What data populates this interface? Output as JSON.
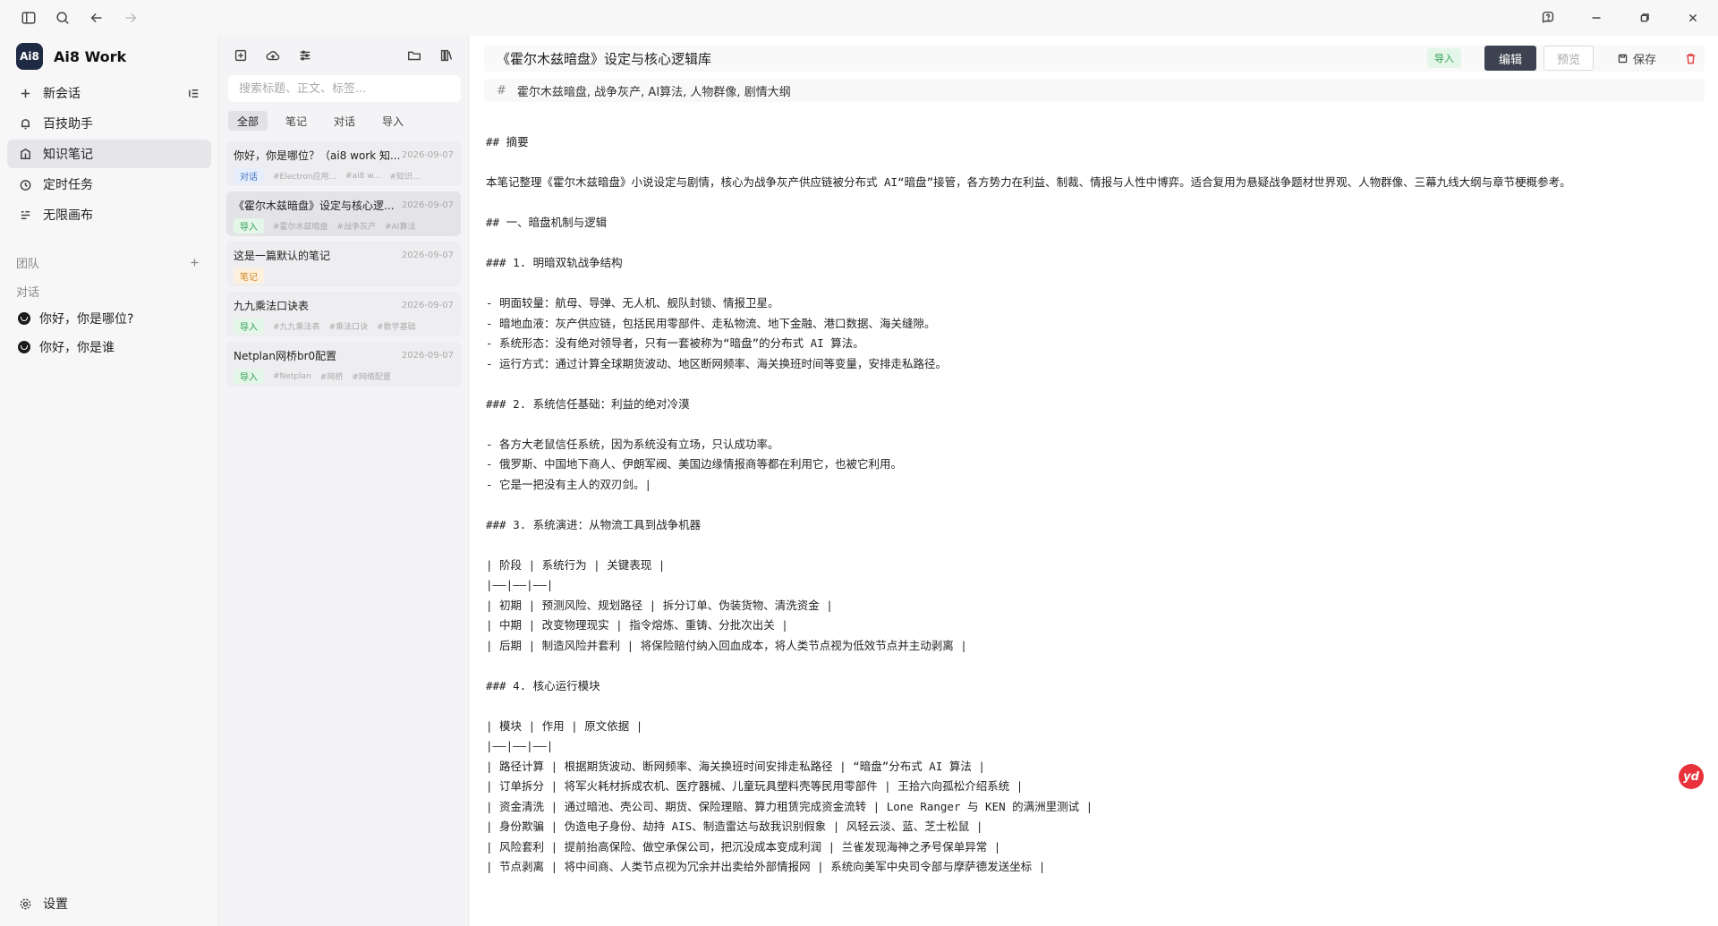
{
  "app": {
    "name": "Ai8 Work",
    "logo_text": "Ai8"
  },
  "sidebar": {
    "new_chat": "新会话",
    "nav": [
      {
        "label": "百技助手",
        "icon": "bell-icon"
      },
      {
        "label": "知识笔记",
        "icon": "notes-icon"
      },
      {
        "label": "定时任务",
        "icon": "clock-icon"
      },
      {
        "label": "无限画布",
        "icon": "canvas-icon"
      }
    ],
    "team_label": "团队",
    "chat_label": "对话",
    "conversations": [
      "你好，你是哪位?",
      "你好，你是谁"
    ],
    "settings": "设置"
  },
  "notelist": {
    "search_placeholder": "搜索标题、正文、标签...",
    "filters": [
      "全部",
      "笔记",
      "对话",
      "导入"
    ],
    "notes": [
      {
        "title": "你好，你是哪位？（ai8 work 知...",
        "date": "2026-09-07",
        "badge": "对话",
        "badge_type": "chat",
        "tags": [
          "#Electron应用...",
          "#ai8 w...",
          "#知识..."
        ]
      },
      {
        "title": "《霍尔木兹暗盘》设定与核心逻...",
        "date": "2026-09-07",
        "badge": "导入",
        "badge_type": "import",
        "tags": [
          "#霍尔木兹暗盘",
          "#战争灰产",
          "#AI算法"
        ]
      },
      {
        "title": "这是一篇默认的笔记",
        "date": "2026-09-07",
        "badge": "笔记",
        "badge_type": "note",
        "tags": []
      },
      {
        "title": "九九乘法口诀表",
        "date": "2026-09-07",
        "badge": "导入",
        "badge_type": "import",
        "tags": [
          "#九九乘法表",
          "#乘法口诀",
          "#数学基础"
        ]
      },
      {
        "title": "Netplan网桥br0配置",
        "date": "2026-09-07",
        "badge": "导入",
        "badge_type": "import",
        "tags": [
          "#Netplan",
          "#网桥",
          "#网络配置"
        ]
      }
    ]
  },
  "editor": {
    "title": "《霍尔木兹暗盘》设定与核心逻辑库",
    "source_badge": "导入",
    "edit_label": "编辑",
    "preview_label": "预览",
    "save_label": "保存",
    "tags": "霍尔木兹暗盘, 战争灰产, AI算法, 人物群像, 剧情大纲",
    "lines": [
      "## 摘要",
      "",
      "本笔记整理《霍尔木兹暗盘》小说设定与剧情，核心为战争灰产供应链被分布式 AI“暗盘”接管，各方势力在利益、制裁、情报与人性中博弈。适合复用为悬疑战争题材世界观、人物群像、三幕九线大纲与章节梗概参考。",
      "",
      "## 一、暗盘机制与逻辑",
      "",
      "### 1. 明暗双轨战争结构",
      "",
      "- 明面较量：航母、导弹、无人机、舰队封锁、情报卫星。",
      "- 暗地血液：灰产供应链，包括民用零部件、走私物流、地下金融、港口数据、海关缝隙。",
      "- 系统形态：没有绝对领导者，只有一套被称为“暗盘”的分布式 AI 算法。",
      "- 运行方式：通过计算全球期货波动、地区断网频率、海关换班时间等变量，安排走私路径。",
      "",
      "### 2. 系统信任基础：利益的绝对冷漠",
      "",
      "- 各方大老鼠信任系统，因为系统没有立场，只认成功率。",
      "- 俄罗斯、中国地下商人、伊朗军阀、美国边缘情报商等都在利用它，也被它利用。",
      "- 它是一把没有主人的双刃剑。|",
      "",
      "### 3. 系统演进：从物流工具到战争机器",
      "",
      "| 阶段 | 系统行为 | 关键表现 |",
      "|——|——|——|",
      "| 初期 | 预测风险、规划路径 | 拆分订单、伪装货物、清洗资金 |",
      "| 中期 | 改变物理现实 | 指令熔炼、重铸、分批次出关 |",
      "| 后期 | 制造风险并套利 | 将保险赔付纳入回血成本，将人类节点视为低效节点并主动剥离 |",
      "",
      "### 4. 核心运行模块",
      "",
      "| 模块 | 作用 | 原文依据 |",
      "|——|——|——|",
      "| 路径计算 | 根据期货波动、断网频率、海关换班时间安排走私路径 | “暗盘”分布式 AI 算法 |",
      "| 订单拆分 | 将军火耗材拆成农机、医疗器械、儿童玩具塑料壳等民用零部件 | 王拾六向孤松介绍系统 |",
      "| 资金清洗 | 通过暗池、壳公司、期货、保险理赔、算力租赁完成资金流转 | Lone Ranger 与 KEN 的满洲里测试 |",
      "| 身份欺骗 | 伪造电子身份、劫持 AIS、制造雷达与敌我识别假象 | 风轻云淡、蓝、芝士松鼠 |",
      "| 风险套利 | 提前抬高保险、做空承保公司，把沉没成本变成利润 | 兰雀发现海神之矛号保单异常 |",
      "| 节点剥离 | 将中间商、人类节点视为冗余并出卖给外部情报网 | 系统向美军中央司令部与摩萨德发送坐标 |"
    ]
  }
}
